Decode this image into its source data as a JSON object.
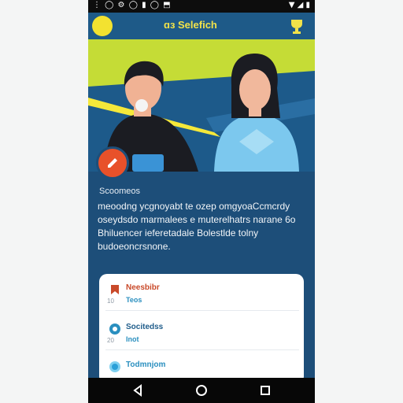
{
  "status_bar": {
    "left_icons": "⋮ ◯ ⚙ ◯ ▮ ◯ ⬒",
    "right_icons": "▼ ◢ ▮"
  },
  "app_bar": {
    "title": "ɑɜ Selefich",
    "menu_icon": "circle-menu-icon",
    "action_icon": "trophy-icon"
  },
  "hero": {
    "illustration": "two-people-illustration"
  },
  "fab": {
    "icon": "pencil-icon",
    "color": "#e8512a"
  },
  "content": {
    "section_label": "Scoomeos",
    "description": "meoodng ycgnoyabt te ozep omgyoaCcmcrdy oseydsdo marmalees e muterelhatrs narane 6o Bhiluencer ieferetadale Bolestlde tolny budoeoncrsnone."
  },
  "list": {
    "items": [
      {
        "icon": "bookmark-icon",
        "title": "Neesbibr",
        "subtitle": "Teos",
        "index": "10",
        "title_color": "#c94a2a",
        "subtitle_color": "#2a8fbf"
      },
      {
        "icon": "chat-bubble-icon",
        "title": "Socitedss",
        "subtitle": "Inot",
        "index": "20",
        "title_color": "#1f5c8a",
        "subtitle_color": "#2a8fbf"
      },
      {
        "icon": "dot-icon",
        "title": "Todmnjom",
        "subtitle": "",
        "index": "",
        "title_color": "#2a8fbf",
        "subtitle_color": "#2a8fbf"
      }
    ]
  },
  "nav_bar": {
    "back": "back-triangle-icon",
    "home": "home-circle-icon",
    "recents": "recents-square-icon"
  },
  "colors": {
    "primary": "#1d4e79",
    "accent": "#f3e230",
    "hero_bg": "#c5dc36",
    "fab": "#e8512a"
  }
}
